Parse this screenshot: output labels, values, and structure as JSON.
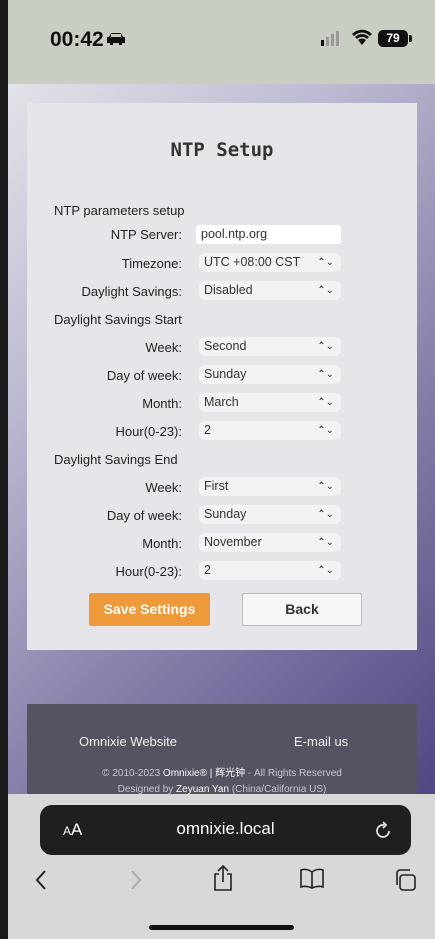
{
  "status": {
    "time": "00:42",
    "battery": "79"
  },
  "page": {
    "title": "NTP Setup",
    "section_ntp": "NTP parameters setup",
    "ntp_server": {
      "label": "NTP Server:",
      "value": "pool.ntp.org"
    },
    "timezone": {
      "label": "Timezone:",
      "value": "UTC +08:00 CST"
    },
    "daylight": {
      "label": "Daylight Savings:",
      "value": "Disabled"
    },
    "section_start": "Daylight Savings Start",
    "start": {
      "week": {
        "label": "Week:",
        "value": "Second"
      },
      "dow": {
        "label": "Day of week:",
        "value": "Sunday"
      },
      "month": {
        "label": "Month:",
        "value": "March"
      },
      "hour": {
        "label": "Hour(0-23):",
        "value": "2"
      }
    },
    "section_end": "Daylight Savings End",
    "end": {
      "week": {
        "label": "Week:",
        "value": "First"
      },
      "dow": {
        "label": "Day of week:",
        "value": "Sunday"
      },
      "month": {
        "label": "Month:",
        "value": "November"
      },
      "hour": {
        "label": "Hour(0-23):",
        "value": "2"
      }
    },
    "save_label": "Save Settings",
    "back_label": "Back"
  },
  "footer": {
    "website_link": "Omnixie Website",
    "email_link": "E-mail us",
    "copyright_prefix": "© 2010-2023",
    "copyright_brand": "Omnixie® | 辉光钟",
    "copyright_suffix": "- All Rights Reserved",
    "designed_prefix": "Designed by",
    "designer": "Zeyuan Yan",
    "designed_suffix": "(China/California US)"
  },
  "safari": {
    "aa_small": "A",
    "aa_large": "A",
    "url": "omnixie.local"
  },
  "icons": [
    "car-icon",
    "signal-icon",
    "wifi-icon",
    "reload-icon",
    "back-icon",
    "forward-icon",
    "share-icon",
    "bookmarks-icon",
    "tabs-icon"
  ],
  "colors": {
    "save_button": "#ef9a3a",
    "footer_bg": "#535361"
  }
}
